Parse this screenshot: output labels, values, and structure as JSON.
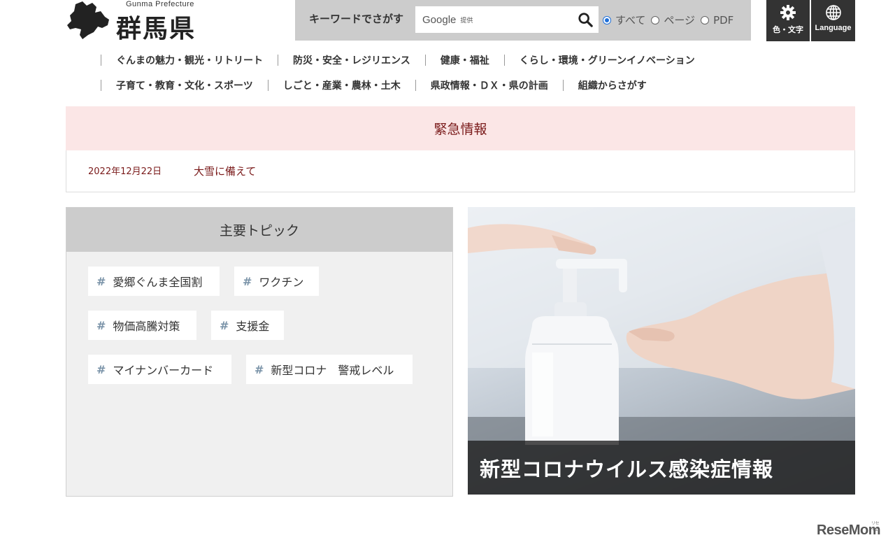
{
  "header": {
    "logo_sub": "Gunma Prefecture",
    "logo_main": "群馬県",
    "search": {
      "label": "キーワードでさがす",
      "brand": "Google",
      "brand_sub": "提供",
      "options": [
        {
          "label": "すべて",
          "selected": true
        },
        {
          "label": "ページ",
          "selected": false
        },
        {
          "label": "PDF",
          "selected": false
        }
      ]
    },
    "color_text_label": "色・文字",
    "language_label": "Language"
  },
  "nav": {
    "row1": [
      "ぐんまの魅力・観光・リトリート",
      "防災・安全・レジリエンス",
      "健康・福祉",
      "くらし・環境・グリーンイノベーション"
    ],
    "row2": [
      "子育て・教育・文化・スポーツ",
      "しごと・産業・農林・土木",
      "県政情報・ＤＸ・県の計画",
      "組織からさがす"
    ]
  },
  "emergency": {
    "title": "緊急情報",
    "date": "2022年12月22日",
    "link": "大雪に備えて"
  },
  "topics": {
    "title": "主要トピック",
    "tags": [
      "愛郷ぐんま全国割",
      "ワクチン",
      "物価高騰対策",
      "支援金",
      "マイナンバーカード",
      "新型コロナ　警戒レベル"
    ]
  },
  "banner": {
    "caption": "新型コロナウイルス感染症情報"
  },
  "watermark": {
    "text": "ReseMom",
    "sub": "リセマム"
  },
  "colors": {
    "emergency_bg": "#fbe6e6",
    "emergency_text": "#7a1a1a",
    "utility_bg": "#333333",
    "search_bg": "#cccccc",
    "radio_accent": "#1e6fd9"
  }
}
